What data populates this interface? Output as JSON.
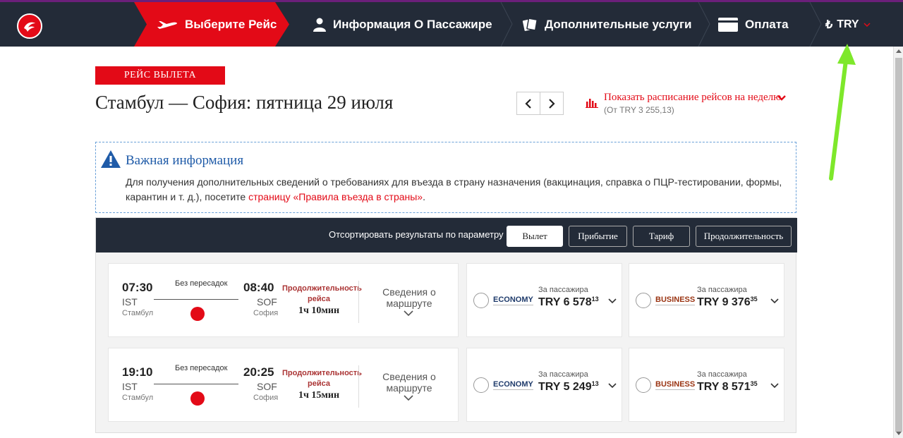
{
  "nav": {
    "steps": [
      {
        "label": "Выберите Рейс",
        "active": true
      },
      {
        "label": "Информация О Пассажире"
      },
      {
        "label": "Дополнительные услуги"
      },
      {
        "label": "Оплата"
      }
    ],
    "currency": "TRY"
  },
  "header": {
    "badge": "РЕЙС ВЫЛЕТА",
    "title": "Стамбул — София: пятница 29 июля",
    "weekly_link": "Показать расписание рейсов на неделю",
    "weekly_sub": "(От TRY 3 255,13)"
  },
  "info": {
    "heading": "Важная информация",
    "text": "Для получения дополнительных сведений о требованиях для въезда в страну назначения (вакцинация, справка о ПЦР-тестировании, формы, карантин и т. д.), посетите ",
    "link": "страницу «Правила въезда в страны»",
    "tail": "."
  },
  "sort": {
    "label": "Отсортировать результаты по параметру",
    "options": [
      "Вылет",
      "Прибытие",
      "Тариф",
      "Продолжительность"
    ]
  },
  "flights": [
    {
      "dep_time": "07:30",
      "dep_code": "IST",
      "dep_city": "Стамбул",
      "stops": "Без пересадок",
      "arr_time": "08:40",
      "arr_code": "SOF",
      "arr_city": "София",
      "duration_label": "Продолжительность рейса",
      "duration": "1ч 10мин",
      "route_details": "Сведения о маршруте",
      "economy": {
        "class": "ECONOMY",
        "per": "За пассажира",
        "price": "TRY 6 578",
        "cents": "13"
      },
      "business": {
        "class": "BUSINESS",
        "per": "За пассажира",
        "price": "TRY 9 376",
        "cents": "35"
      }
    },
    {
      "dep_time": "19:10",
      "dep_code": "IST",
      "dep_city": "Стамбул",
      "stops": "Без пересадок",
      "arr_time": "20:25",
      "arr_code": "SOF",
      "arr_city": "София",
      "duration_label": "Продолжительность рейса",
      "duration": "1ч 15мин",
      "route_details": "Сведения о маршруте",
      "economy": {
        "class": "ECONOMY",
        "per": "За пассажира",
        "price": "TRY 5 249",
        "cents": "13"
      },
      "business": {
        "class": "BUSINESS",
        "per": "За пассажира",
        "price": "TRY 8 571",
        "cents": "35"
      }
    }
  ],
  "colors": {
    "brand_red": "#e30a17",
    "nav_bg": "#232b38",
    "info_blue": "#1f5ba8",
    "annotation_green": "#7ee82b"
  }
}
